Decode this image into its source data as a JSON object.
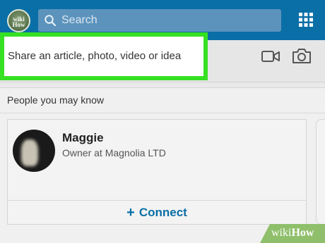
{
  "top_bar": {
    "logo_text_line1": "wiki",
    "logo_text_line2": "How",
    "search": {
      "placeholder": "Search",
      "icon": "search-icon"
    },
    "apps_icon": "grid-icon"
  },
  "share_bar": {
    "prompt": "Share an article, photo, video or idea",
    "video_icon": "video-camera-icon",
    "photo_icon": "camera-icon"
  },
  "people_you_may_know": {
    "title": "People you may know",
    "cards": [
      {
        "name": "Maggie",
        "headline": "Owner at Magnolia LTD",
        "connect_label": "Connect"
      }
    ]
  },
  "watermark": {
    "part1": "wiki",
    "part2": "How"
  },
  "colors": {
    "brand_blue": "#0a6fa6",
    "search_bg": "#5c93bd",
    "highlight_green": "#36e022",
    "watermark_green": "#8fbf6b"
  }
}
